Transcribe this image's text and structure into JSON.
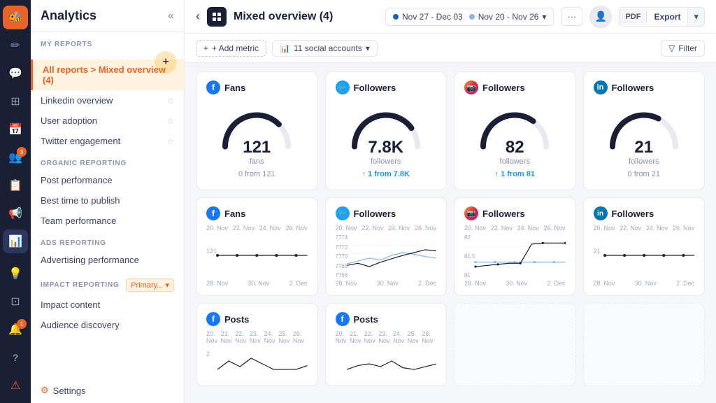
{
  "app": {
    "title": "Analytics"
  },
  "nav": {
    "icons": [
      {
        "name": "brand-icon",
        "symbol": "🐝",
        "active": false,
        "brand": true
      },
      {
        "name": "compose-icon",
        "symbol": "✏️",
        "active": false
      },
      {
        "name": "inbox-icon",
        "symbol": "💬",
        "active": false
      },
      {
        "name": "grid-icon",
        "symbol": "⊞",
        "active": false
      },
      {
        "name": "calendar-icon",
        "symbol": "📅",
        "active": false
      },
      {
        "name": "users-icon",
        "symbol": "👥",
        "active": false,
        "badge": true
      },
      {
        "name": "clipboard-icon",
        "symbol": "📋",
        "active": false
      },
      {
        "name": "megaphone-icon",
        "symbol": "📢",
        "active": false
      },
      {
        "name": "chart-icon",
        "symbol": "📊",
        "active": true
      },
      {
        "name": "bulb-icon",
        "symbol": "💡",
        "active": false
      },
      {
        "name": "grid2-icon",
        "symbol": "⊡",
        "active": false
      },
      {
        "name": "bell-icon",
        "symbol": "🔔",
        "active": false,
        "badge": true
      },
      {
        "name": "help-icon",
        "symbol": "?",
        "active": false
      },
      {
        "name": "warning-icon",
        "symbol": "⚠️",
        "active": false
      }
    ]
  },
  "sidebar": {
    "title": "Analytics",
    "sections": [
      {
        "label": "MY REPORTS",
        "items": [
          {
            "label": "All reports > Mixed overview (4)",
            "active": true,
            "pin": false
          },
          {
            "label": "Linkedin overview",
            "active": false,
            "pin": true
          },
          {
            "label": "User adoption",
            "active": false,
            "pin": true
          },
          {
            "label": "Twitter engagement",
            "active": false,
            "pin": true
          }
        ]
      },
      {
        "label": "ORGANIC REPORTING",
        "items": [
          {
            "label": "Post performance",
            "active": false,
            "pin": false
          },
          {
            "label": "Best time to publish",
            "active": false,
            "pin": false
          },
          {
            "label": "Team performance",
            "active": false,
            "pin": false
          }
        ]
      },
      {
        "label": "ADS REPORTING",
        "items": [
          {
            "label": "Advertising performance",
            "active": false,
            "pin": false
          }
        ]
      }
    ],
    "impact_reporting": {
      "label": "IMPACT REPORTING",
      "badge": "Primary...",
      "items": [
        {
          "label": "Impact content",
          "active": false
        },
        {
          "label": "Audience discovery",
          "active": false
        }
      ]
    },
    "settings": "⚙ Settings"
  },
  "topbar": {
    "title": "Mixed overview (4)",
    "date1": "Nov 27 - Dec 03",
    "date2": "Nov 20 - Nov 26",
    "export_label": "Export",
    "pdf_label": "PDF"
  },
  "filterbar": {
    "add_metric": "+ Add metric",
    "accounts": "11 social accounts",
    "filter": "Filter"
  },
  "gauge_cards": [
    {
      "platform": "fb",
      "platform_label": "Fans",
      "icon_letter": "f",
      "value": "121",
      "sub": "fans",
      "change_text": "0 from 121",
      "change_type": "zero",
      "gauge_pct": 75
    },
    {
      "platform": "tw",
      "platform_label": "Followers",
      "icon_letter": "t",
      "value": "7.8K",
      "sub": "followers",
      "change_text": "↑ 1 from 7.8K",
      "change_type": "positive",
      "gauge_pct": 80
    },
    {
      "platform": "ig",
      "platform_label": "Followers",
      "icon_letter": "ig",
      "value": "82",
      "sub": "followers",
      "change_text": "↑ 1 from 81",
      "change_type": "positive",
      "gauge_pct": 70
    },
    {
      "platform": "li",
      "platform_label": "Followers",
      "icon_letter": "in",
      "value": "21",
      "sub": "followers",
      "change_text": "0 from 21",
      "change_type": "zero",
      "gauge_pct": 65
    }
  ],
  "chart_cards": [
    {
      "platform": "fb",
      "platform_label": "Fans",
      "x_labels": [
        "20. Nov",
        "22. Nov",
        "24. Nov",
        "26. Nov"
      ],
      "x_labels2": [
        "28. Nov",
        "30. Nov",
        "2. Dec"
      ],
      "y_labels": [
        "",
        "121",
        ""
      ],
      "value_center": "121",
      "line_type": "flat"
    },
    {
      "platform": "tw",
      "platform_label": "Followers",
      "x_labels": [
        "20. Nov",
        "22. Nov",
        "24. Nov",
        "26. Nov"
      ],
      "x_labels2": [
        "28. Nov",
        "30. Nov",
        "2. Dec"
      ],
      "y_labels": [
        "7774",
        "7772",
        "7770",
        "7768",
        "7766"
      ],
      "line_type": "wave"
    },
    {
      "platform": "ig",
      "platform_label": "Followers",
      "x_labels": [
        "20. Nov",
        "22. Nov",
        "24. Nov",
        "26. Nov"
      ],
      "x_labels2": [
        "28. Nov",
        "30. Nov",
        "2. Dec"
      ],
      "y_labels": [
        "82",
        "81.5",
        "81"
      ],
      "line_type": "spike"
    },
    {
      "platform": "li",
      "platform_label": "Followers",
      "x_labels": [
        "20. Nov",
        "22. Nov",
        "24. Nov",
        "26. Nov"
      ],
      "x_labels2": [
        "28. Nov",
        "30. Nov",
        "2. Dec"
      ],
      "y_labels": [
        "",
        "21",
        ""
      ],
      "line_type": "flat"
    }
  ],
  "posts_cards": [
    {
      "platform": "fb",
      "label": "Posts",
      "x_labels": [
        "20. Nov",
        "21. Nov",
        "22. Nov",
        "23. Nov",
        "24. Nov",
        "25. Nov",
        "26. Nov"
      ],
      "y_start": "2"
    },
    {
      "platform": "fb",
      "label": "Posts",
      "x_labels": [
        "20. Nov",
        "21. Nov",
        "22. Nov",
        "23. Nov",
        "24. Nov",
        "25. Nov",
        "26. Nov"
      ],
      "y_start": ""
    }
  ],
  "colors": {
    "accent": "#e8632a",
    "fb": "#1877f2",
    "tw": "#1da1f2",
    "li": "#0077b5",
    "dark": "#1a1f36",
    "gauge_track": "#e8eaf0",
    "gauge_fill": "#1a1f36"
  }
}
